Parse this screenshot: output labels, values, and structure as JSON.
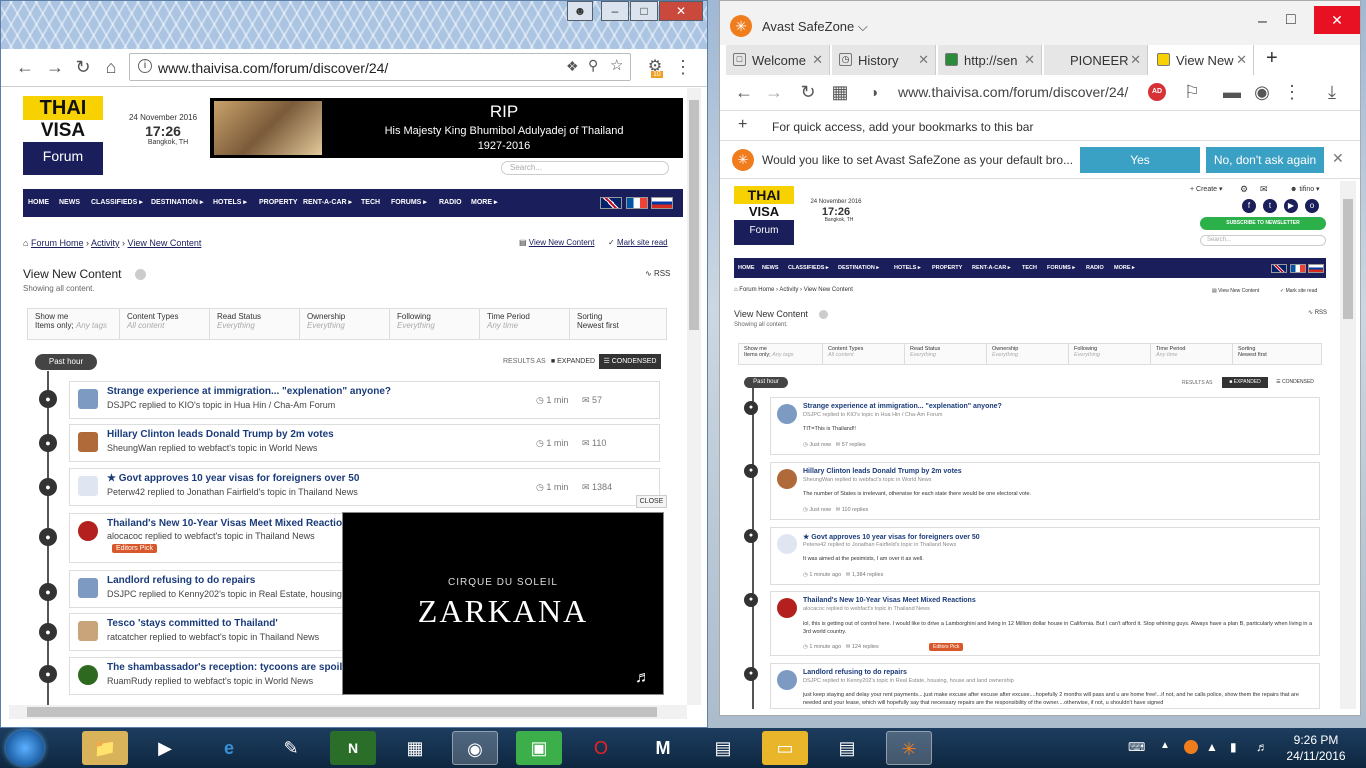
{
  "left_browser": {
    "url": "www.thaivisa.com/forum/discover/24/",
    "ext_badge": "10"
  },
  "right_browser": {
    "app_name": "Avast SafeZone",
    "tabs": [
      "Welcome",
      "History",
      "http://sen",
      "PIONEER",
      "View New"
    ],
    "url": "www.thaivisa.com/forum/discover/24/",
    "ad_badge": "AD",
    "bookmarks_hint": "For quick access, add your bookmarks to this bar",
    "default_prompt": "Would you like to set Avast SafeZone as your default bro...",
    "yes_label": "Yes",
    "no_label": "No, don't ask again"
  },
  "site": {
    "logo_top": "THAI",
    "logo_mid": "VISA",
    "logo_bottom": "Forum",
    "date": "24 November 2016",
    "time": "17:26",
    "location": "Bangkok, TH",
    "rip": "RIP",
    "king": "His Majesty King Bhumibol Adulyadej of Thailand",
    "years": "1927-2016",
    "search_placeholder": "Search...",
    "nav": [
      "HOME",
      "NEWS",
      "CLASSIFIEDS ▸",
      "DESTINATION ▸",
      "HOTELS ▸",
      "PROPERTY",
      "RENT-A-CAR ▸",
      "TECH",
      "FORUMS ▸",
      "RADIO",
      "MORE ▸"
    ],
    "crumb_home": "Forum Home",
    "crumb_activity": "Activity",
    "crumb_current": "View New Content",
    "view_new": "View New Content",
    "mark_read": "Mark site read",
    "page_title": "View New Content",
    "page_sub": "Showing all content.",
    "rss": "RSS",
    "create": "Create",
    "user": "tifino",
    "subscribe": "SUBSCRIBE TO NEWSLETTER",
    "filters": [
      {
        "a": "Show me",
        "b": "Items only;",
        "c": "Any tags"
      },
      {
        "a": "Content Types",
        "b": "All content"
      },
      {
        "a": "Read Status",
        "b": "Everything"
      },
      {
        "a": "Ownership",
        "b": "Everything"
      },
      {
        "a": "Following",
        "b": "Everything"
      },
      {
        "a": "Time Period",
        "b": "Any time"
      },
      {
        "a": "Sorting",
        "b": "Newest first"
      }
    ],
    "past_hour": "Past hour",
    "results_as": "RESULTS AS",
    "expanded": "EXPANDED",
    "condensed": "CONDENSED",
    "close": "CLOSE",
    "video_line1": "CIRQUE DU SOLEIL",
    "video_line2": "ZARKANA",
    "editors_pick": "Editors Pick"
  },
  "topics": [
    {
      "title": "Strange experience at immigration... \"explenation\" anyone?",
      "by": "DSJPC replied to KIO's topic in Hua Hin / Cha-Am Forum",
      "time": "1 min",
      "replies": "57",
      "exp_time": "Just now",
      "exp_replies": "57 replies",
      "body": "TIT=This is Thailand!!"
    },
    {
      "title": "Hillary Clinton leads Donald Trump by 2m votes",
      "by": "SheungWan replied to webfact's topic in World News",
      "time": "1 min",
      "replies": "110",
      "exp_time": "Just now",
      "exp_replies": "110 replies",
      "body": "The number of States is irrelevant, otherwise for each state there would be one electoral vote."
    },
    {
      "title": "Govt approves 10 year visas for foreigners over 50",
      "by": "Peterw42 replied to Jonathan Fairfield's topic in Thailand News",
      "time": "1 min",
      "replies": "1384",
      "exp_time": "1 minute ago",
      "exp_replies": "1,384 replies",
      "body": "It was aimed at the pesimists, I am over it as well."
    },
    {
      "title": "Thailand's New 10-Year Visas Meet Mixed Reactions",
      "by": "alocacoc replied to webfact's topic in Thailand News",
      "exp_time": "1 minute ago",
      "exp_replies": "124 replies",
      "body": "lol, this is getting out of control here. I would like to drive a Lamborghini and living in 12 Million dollar house in California. But I can't afford it. Stop whining guys. Always have a plan B, particularly when living in a 3rd world country."
    },
    {
      "title": "Landlord refusing to do repairs",
      "by": "DSJPC replied to Kenny202's topic in Real Estate, housing, house and land ownership",
      "body": "just keep staying and delay your rent payments....just make excuse after excuse after excuse....hopefully 2 months will pass and u are home free!...if not, and he calls police, show them the repairs that are needed and your lease, which will hopefully say that necessary repairs are the responsibility of the owner....otherwise, if not, u shouldn't have signed"
    },
    {
      "title": "Tesco 'stays committed to Thailand'",
      "by": "ratcatcher replied to webfact's topic in Thailand News"
    },
    {
      "title": "The shambassador's reception: tycoons are spoiling N",
      "by": "RuamRudy replied to webfact's topic in World News"
    }
  ],
  "taskbar": {
    "time": "9:26 PM",
    "date": "24/11/2016"
  }
}
